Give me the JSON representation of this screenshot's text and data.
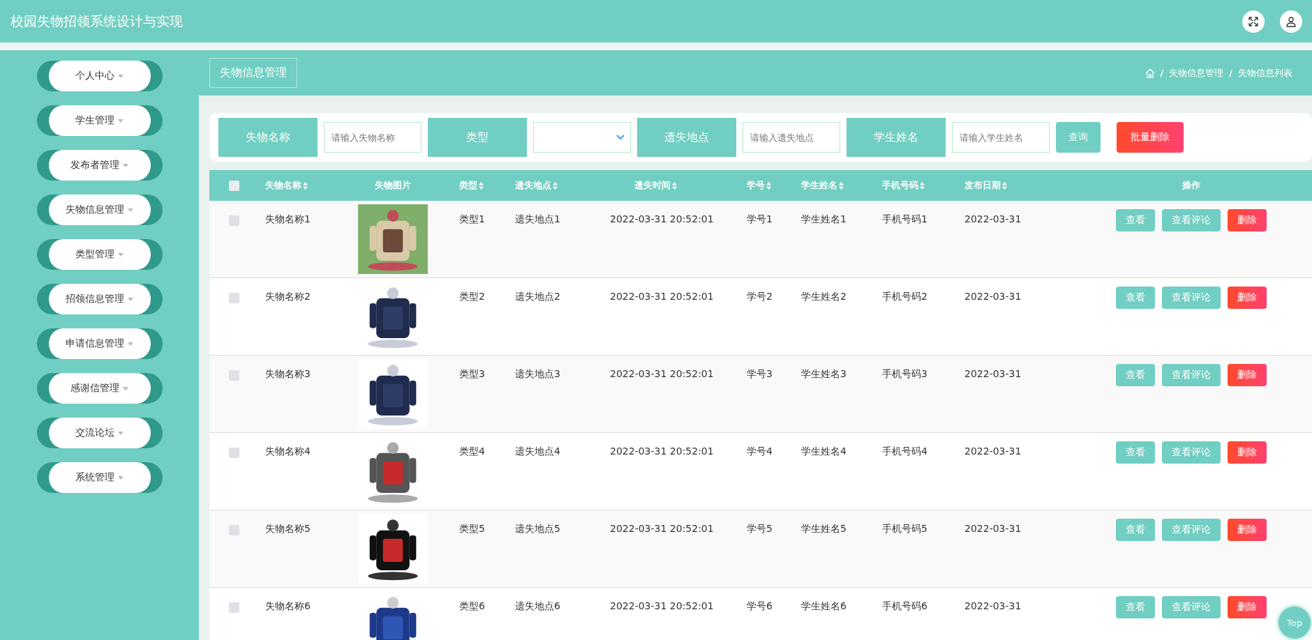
{
  "header": {
    "title": "校园失物招领系统设计与实现"
  },
  "sidebar": {
    "items": [
      {
        "label": "个人中心"
      },
      {
        "label": "学生管理"
      },
      {
        "label": "发布者管理"
      },
      {
        "label": "失物信息管理"
      },
      {
        "label": "类型管理"
      },
      {
        "label": "招领信息管理"
      },
      {
        "label": "申请信息管理"
      },
      {
        "label": "感谢信管理"
      },
      {
        "label": "交流论坛"
      },
      {
        "label": "系统管理"
      }
    ]
  },
  "page_title": "失物信息管理",
  "breadcrumb": [
    {
      "kind": "separator",
      "text": "/"
    },
    {
      "kind": "link",
      "text": "失物信息管理"
    },
    {
      "kind": "separator",
      "text": "/"
    },
    {
      "kind": "link",
      "text": "失物信息列表"
    }
  ],
  "search": {
    "fields": [
      {
        "label": "失物名称",
        "kind": "text",
        "placeholder": "请输入失物名称"
      },
      {
        "label": "类型",
        "kind": "select"
      },
      {
        "label": "遗失地点",
        "kind": "text",
        "placeholder": "请输入遗失地点"
      },
      {
        "label": "学生姓名",
        "kind": "text",
        "placeholder": "请输入学生姓名"
      }
    ],
    "query_button": "查询",
    "batch_delete_button": "批量删除"
  },
  "table": {
    "select_all": {
      "checked": false
    },
    "columns": [
      {
        "label": "失物名称",
        "sortable": true
      },
      {
        "label": "失物图片",
        "sortable": false
      },
      {
        "label": "类型",
        "sortable": true
      },
      {
        "label": "遗失地点",
        "sortable": true
      },
      {
        "label": "遗失时间",
        "sortable": true
      },
      {
        "label": "学号",
        "sortable": true
      },
      {
        "label": "学生姓名",
        "sortable": true
      },
      {
        "label": "手机号码",
        "sortable": true
      },
      {
        "label": "发布日期",
        "sortable": true
      },
      {
        "label": "操作",
        "sortable": false
      }
    ],
    "rows": [
      {
        "checked": false,
        "cells": [
          {
            "kind": "text",
            "text": "失物名称1"
          },
          {
            "kind": "picture"
          },
          {
            "kind": "text",
            "text": "类型1"
          },
          {
            "kind": "text",
            "text": "遗失地点1"
          },
          {
            "kind": "text",
            "text": "2022-03-31 20:52:01"
          },
          {
            "kind": "text",
            "text": "学号1"
          },
          {
            "kind": "text",
            "text": "学生姓名1"
          },
          {
            "kind": "text",
            "text": "手机号码1"
          },
          {
            "kind": "text",
            "text": "2022-03-31"
          },
          {
            "kind": "actions",
            "buttons": [
              "查看",
              "查看评论",
              "删除"
            ]
          }
        ]
      },
      {
        "checked": false,
        "cells": [
          {
            "kind": "text",
            "text": "失物名称2"
          },
          {
            "kind": "picture"
          },
          {
            "kind": "text",
            "text": "类型2"
          },
          {
            "kind": "text",
            "text": "遗失地点2"
          },
          {
            "kind": "text",
            "text": "2022-03-31 20:52:01"
          },
          {
            "kind": "text",
            "text": "学号2"
          },
          {
            "kind": "text",
            "text": "学生姓名2"
          },
          {
            "kind": "text",
            "text": "手机号码2"
          },
          {
            "kind": "text",
            "text": "2022-03-31"
          },
          {
            "kind": "actions",
            "buttons": [
              "查看",
              "查看评论",
              "删除"
            ]
          }
        ]
      },
      {
        "checked": false,
        "cells": [
          {
            "kind": "text",
            "text": "失物名称3"
          },
          {
            "kind": "picture"
          },
          {
            "kind": "text",
            "text": "类型3"
          },
          {
            "kind": "text",
            "text": "遗失地点3"
          },
          {
            "kind": "text",
            "text": "2022-03-31 20:52:01"
          },
          {
            "kind": "text",
            "text": "学号3"
          },
          {
            "kind": "text",
            "text": "学生姓名3"
          },
          {
            "kind": "text",
            "text": "手机号码3"
          },
          {
            "kind": "text",
            "text": "2022-03-31"
          },
          {
            "kind": "actions",
            "buttons": [
              "查看",
              "查看评论",
              "删除"
            ]
          }
        ]
      },
      {
        "checked": false,
        "cells": [
          {
            "kind": "text",
            "text": "失物名称4"
          },
          {
            "kind": "picture"
          },
          {
            "kind": "text",
            "text": "类型4"
          },
          {
            "kind": "text",
            "text": "遗失地点4"
          },
          {
            "kind": "text",
            "text": "2022-03-31 20:52:01"
          },
          {
            "kind": "text",
            "text": "学号4"
          },
          {
            "kind": "text",
            "text": "学生姓名4"
          },
          {
            "kind": "text",
            "text": "手机号码4"
          },
          {
            "kind": "text",
            "text": "2022-03-31"
          },
          {
            "kind": "actions",
            "buttons": [
              "查看",
              "查看评论",
              "删除"
            ]
          }
        ]
      },
      {
        "checked": false,
        "cells": [
          {
            "kind": "text",
            "text": "失物名称5"
          },
          {
            "kind": "picture"
          },
          {
            "kind": "text",
            "text": "类型5"
          },
          {
            "kind": "text",
            "text": "遗失地点5"
          },
          {
            "kind": "text",
            "text": "2022-03-31 20:52:01"
          },
          {
            "kind": "text",
            "text": "学号5"
          },
          {
            "kind": "text",
            "text": "学生姓名5"
          },
          {
            "kind": "text",
            "text": "手机号码5"
          },
          {
            "kind": "text",
            "text": "2022-03-31"
          },
          {
            "kind": "actions",
            "buttons": [
              "查看",
              "查看评论",
              "删除"
            ]
          }
        ]
      },
      {
        "checked": false,
        "cells": [
          {
            "kind": "text",
            "text": "失物名称6"
          },
          {
            "kind": "picture"
          },
          {
            "kind": "text",
            "text": "类型6"
          },
          {
            "kind": "text",
            "text": "遗失地点6"
          },
          {
            "kind": "text",
            "text": "2022-03-31 20:52:01"
          },
          {
            "kind": "text",
            "text": "学号6"
          },
          {
            "kind": "text",
            "text": "学生姓名6"
          },
          {
            "kind": "text",
            "text": "手机号码6"
          },
          {
            "kind": "text",
            "text": "2022-03-31"
          },
          {
            "kind": "actions",
            "buttons": [
              "查看",
              "查看评论",
              "删除"
            ]
          }
        ]
      }
    ]
  },
  "top_button": "Top"
}
